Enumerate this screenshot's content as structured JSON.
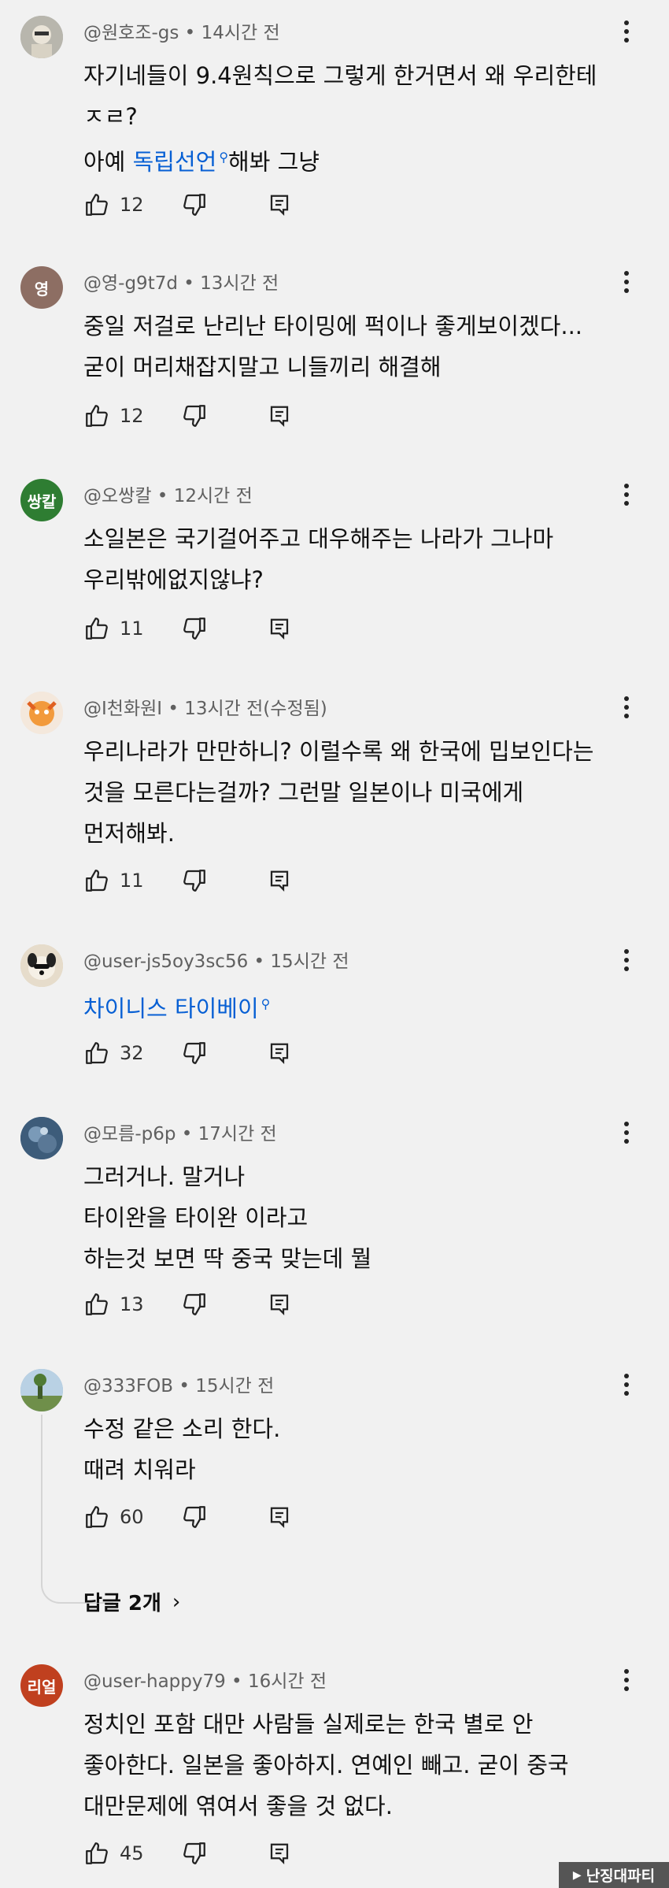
{
  "comments": [
    {
      "handle": "@원호조-gs",
      "time": "14시간 전",
      "avatar_text": "",
      "avatar_color": "#9aa0a6",
      "lines": [
        "자기네들이 9.4원칙으로 그렇게 한거면서 왜 우리한테",
        "ㅈㄹ?"
      ],
      "link_line": {
        "prefix": "아예 ",
        "link": "독립선언",
        "suffix": "해봐 그냥"
      },
      "likes": "12"
    },
    {
      "handle": "@영-g9t7d",
      "time": "13시간 전",
      "avatar_text": "영",
      "avatar_color": "#8d6e63",
      "lines": [
        "중일 저걸로 난리난 타이밍에 퍽이나 좋게보이겠다...",
        "굳이 머리채잡지말고 니들끼리 해결해"
      ],
      "likes": "12"
    },
    {
      "handle": "@오쌍칼",
      "time": "12시간 전",
      "avatar_text": "쌍칼",
      "avatar_color": "#2e7d32",
      "lines": [
        "소일본은  국기걸어주고 대우해주는 나라가 그나마",
        "우리밖에없지않냐?"
      ],
      "likes": "11"
    },
    {
      "handle": "@I천화원I",
      "time": "13시간 전(수정됨)",
      "avatar_text": "",
      "avatar_color": "#ef8a3a",
      "lines": [
        "우리나라가 만만하니? 이럴수록 왜 한국에 밉보인다는",
        "것을 모른다는걸까? 그런말 일본이나 미국에게",
        "먼저해봐."
      ],
      "likes": "11"
    },
    {
      "handle": "@user-js5oy3sc56",
      "time": "15시간 전",
      "avatar_text": "",
      "avatar_color": "#d9c9a8",
      "link_only": "차이니스 타이베이",
      "lines": [],
      "likes": "32"
    },
    {
      "handle": "@모름-p6p",
      "time": "17시간 전",
      "avatar_text": "",
      "avatar_color": "#4a6a8a",
      "lines": [
        "그러거나. 말거나",
        "타이완을 타이완 이라고",
        "하는것 보면 딱 중국 맞는데 뭘"
      ],
      "likes": "13"
    },
    {
      "handle": "@333FOB",
      "time": "15시간 전",
      "avatar_text": "",
      "avatar_color": "#8fb0c8",
      "lines": [
        "수정 같은  소리 한다.",
        "때려 치워라"
      ],
      "likes": "60",
      "replies": "답글 2개"
    },
    {
      "handle": "@user-happy79",
      "time": "16시간 전",
      "avatar_text": "리얼",
      "avatar_color": "#c0401f",
      "lines": [
        "정치인 포함 대만 사람들 실제로는 한국 별로 안",
        "좋아한다. 일본을 좋아하지. 연예인 빼고. 굳이 중국",
        "대만문제에 엮여서 좋을 것 없다."
      ],
      "likes": "45"
    }
  ],
  "watermark": "난징대파티",
  "icons": {
    "like": "thumbs-up-icon",
    "dislike": "thumbs-down-icon",
    "reply": "reply-comment-icon",
    "more": "more-vert-icon",
    "search": "search-magnifier-icon",
    "chevron": "chevron-right-icon"
  }
}
